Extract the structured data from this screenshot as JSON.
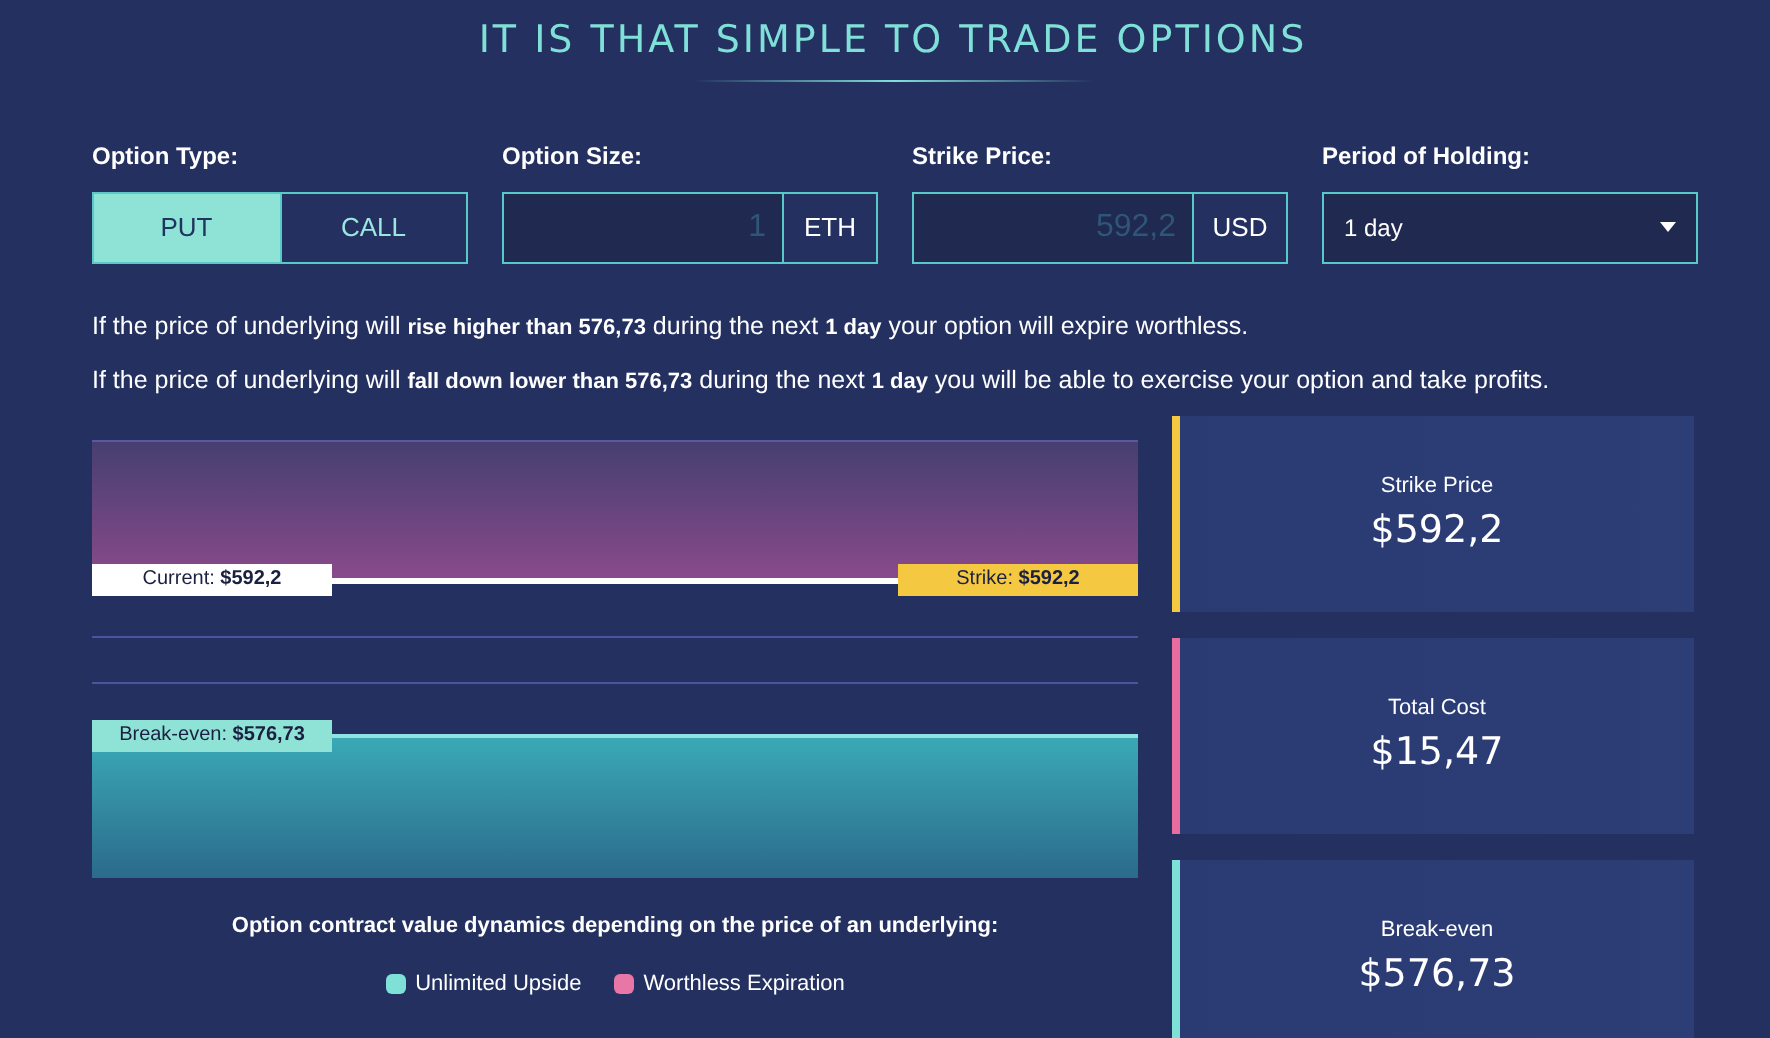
{
  "title": "IT IS THAT SIMPLE TO TRADE OPTIONS",
  "form": {
    "option_type": {
      "label": "Option Type:",
      "options": [
        {
          "label": "PUT",
          "selected": true
        },
        {
          "label": "CALL",
          "selected": false
        }
      ]
    },
    "option_size": {
      "label": "Option Size:",
      "placeholder": "1",
      "unit": "ETH"
    },
    "strike_price": {
      "label": "Strike Price:",
      "placeholder": "592,2",
      "unit": "USD"
    },
    "period": {
      "label": "Period of Holding:",
      "value": "1 day"
    }
  },
  "sentences": [
    "If the price of underlying will **rise higher than 576,73** during the next **1 day** your option will expire worthless.",
    "If the price of underlying will **fall down lower than 576,73** during the next **1 day** you will be able to exercise your option and take profits."
  ],
  "chart": {
    "current_label": "Current: **$592,2**",
    "strike_label": "Strike: **$592,2**",
    "break_even_label": "Break-even: **$576,73**",
    "caption": "Option contract value dynamics depending on the price of an underlying:",
    "legend": [
      {
        "label": "Unlimited Upside",
        "color": "#7fe0d8"
      },
      {
        "label": "Worthless Expiration",
        "color": "#e877a8"
      }
    ]
  },
  "cards": [
    {
      "label": "Strike Price",
      "value": "$592,2",
      "color": "#f5c842"
    },
    {
      "label": "Total Cost",
      "value": "$15,47",
      "color": "#e86ca0"
    },
    {
      "label": "Break-even",
      "value": "$576,73",
      "color": "#7fe0d8"
    }
  ]
}
